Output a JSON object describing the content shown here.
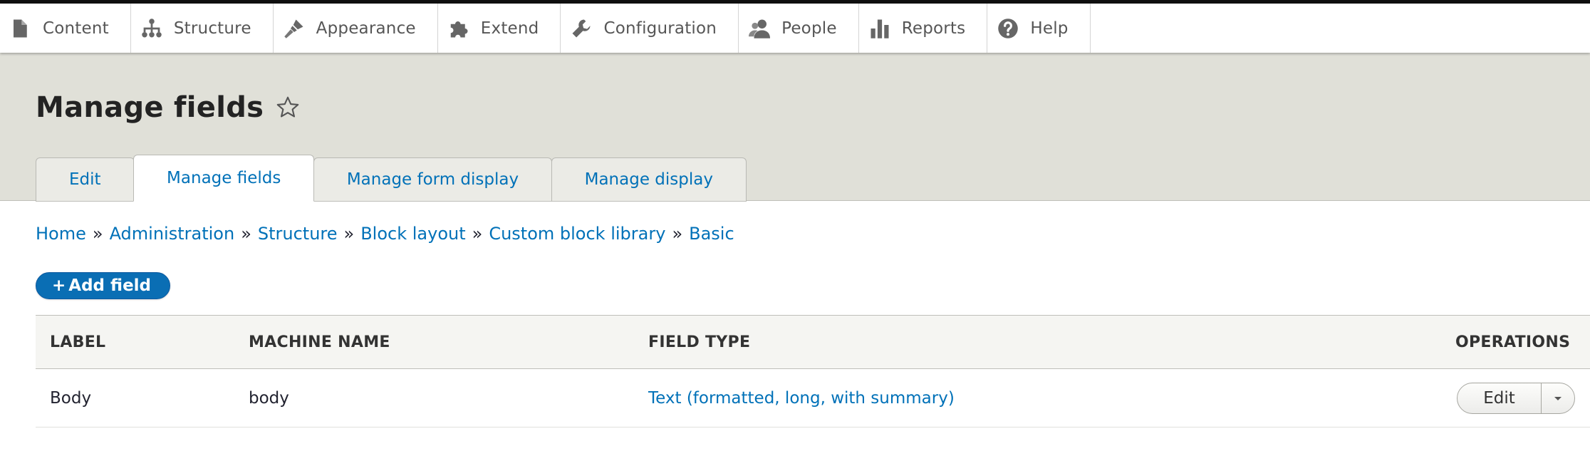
{
  "toolbar": {
    "items": [
      {
        "label": "Content",
        "icon": "document-icon"
      },
      {
        "label": "Structure",
        "icon": "sitemap-icon"
      },
      {
        "label": "Appearance",
        "icon": "paintbrush-icon"
      },
      {
        "label": "Extend",
        "icon": "puzzle-icon"
      },
      {
        "label": "Configuration",
        "icon": "wrench-icon"
      },
      {
        "label": "People",
        "icon": "people-icon"
      },
      {
        "label": "Reports",
        "icon": "bar-chart-icon"
      },
      {
        "label": "Help",
        "icon": "question-icon"
      }
    ]
  },
  "header": {
    "title": "Manage fields",
    "tabs": [
      {
        "label": "Edit",
        "active": false
      },
      {
        "label": "Manage fields",
        "active": true
      },
      {
        "label": "Manage form display",
        "active": false
      },
      {
        "label": "Manage display",
        "active": false
      }
    ]
  },
  "breadcrumb": {
    "items": [
      "Home",
      "Administration",
      "Structure",
      "Block layout",
      "Custom block library",
      "Basic"
    ],
    "separator": "»"
  },
  "actions": {
    "add_plus": "+",
    "add_label": "Add field"
  },
  "table": {
    "headers": [
      "Label",
      "Machine name",
      "Field type",
      "Operations"
    ],
    "rows": [
      {
        "label": "Body",
        "machine_name": "body",
        "field_type": "Text (formatted, long, with summary)",
        "operation": "Edit"
      }
    ]
  },
  "colors": {
    "link": "#0071b8",
    "header_bg": "#e0e0d8",
    "primary_button": "#0a6eb4"
  }
}
